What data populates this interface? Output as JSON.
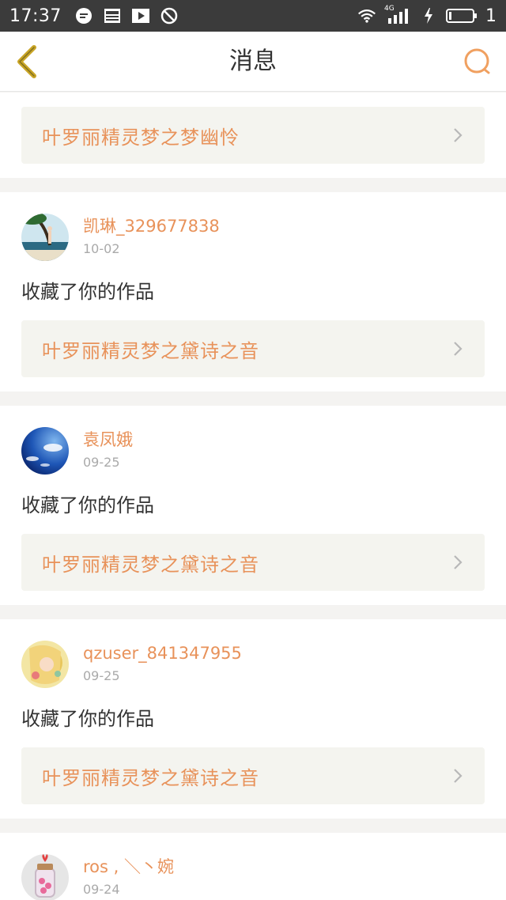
{
  "status_bar": {
    "time": "17:37",
    "network": "4G",
    "battery_text": "1",
    "icons_left": [
      "chat-bubble-icon",
      "news-icon",
      "play-icon",
      "block-icon"
    ],
    "icons_right": [
      "wifi-icon",
      "signal-icon",
      "charging-icon",
      "battery-icon"
    ]
  },
  "header": {
    "title": "消息",
    "accent_color": "#e8925a"
  },
  "first_card": {
    "work_title": "叶罗丽精灵梦之梦幽怜"
  },
  "messages": [
    {
      "username": "凯琳_329677838",
      "date": "10-02",
      "action": "收藏了你的作品",
      "work_title": "叶罗丽精灵梦之黛诗之音",
      "avatar": "beach-person"
    },
    {
      "username": "袁凤娥",
      "date": "09-25",
      "action": "收藏了你的作品",
      "work_title": "叶罗丽精灵梦之黛诗之音",
      "avatar": "blue-sky"
    },
    {
      "username": "qzuser_841347955",
      "date": "09-25",
      "action": "收藏了你的作品",
      "work_title": "叶罗丽精灵梦之黛诗之音",
      "avatar": "anime-girl"
    },
    {
      "username": "ros , ＼丶婉",
      "date": "09-24",
      "avatar": "heart-jar"
    }
  ]
}
